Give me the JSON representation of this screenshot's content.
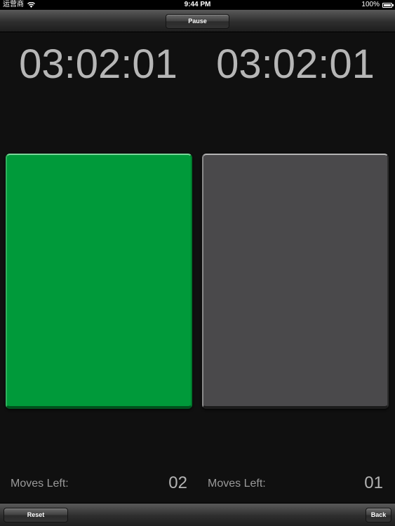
{
  "status_bar": {
    "carrier": "运营商",
    "time": "9:44 PM",
    "battery": "100%"
  },
  "toolbar": {
    "pause_label": "Pause"
  },
  "players": [
    {
      "timer": "03:02:01",
      "moves_label": "Moves Left:",
      "moves_value": "02",
      "pad_color": "#009a3a",
      "active": true
    },
    {
      "timer": "03:02:01",
      "moves_label": "Moves Left:",
      "moves_value": "01",
      "pad_color": "#4a494b",
      "active": false
    }
  ],
  "bottom_bar": {
    "reset_label": "Reset",
    "back_label": "Back"
  },
  "icons": {
    "wifi": "wifi-icon",
    "battery": "battery-icon"
  }
}
